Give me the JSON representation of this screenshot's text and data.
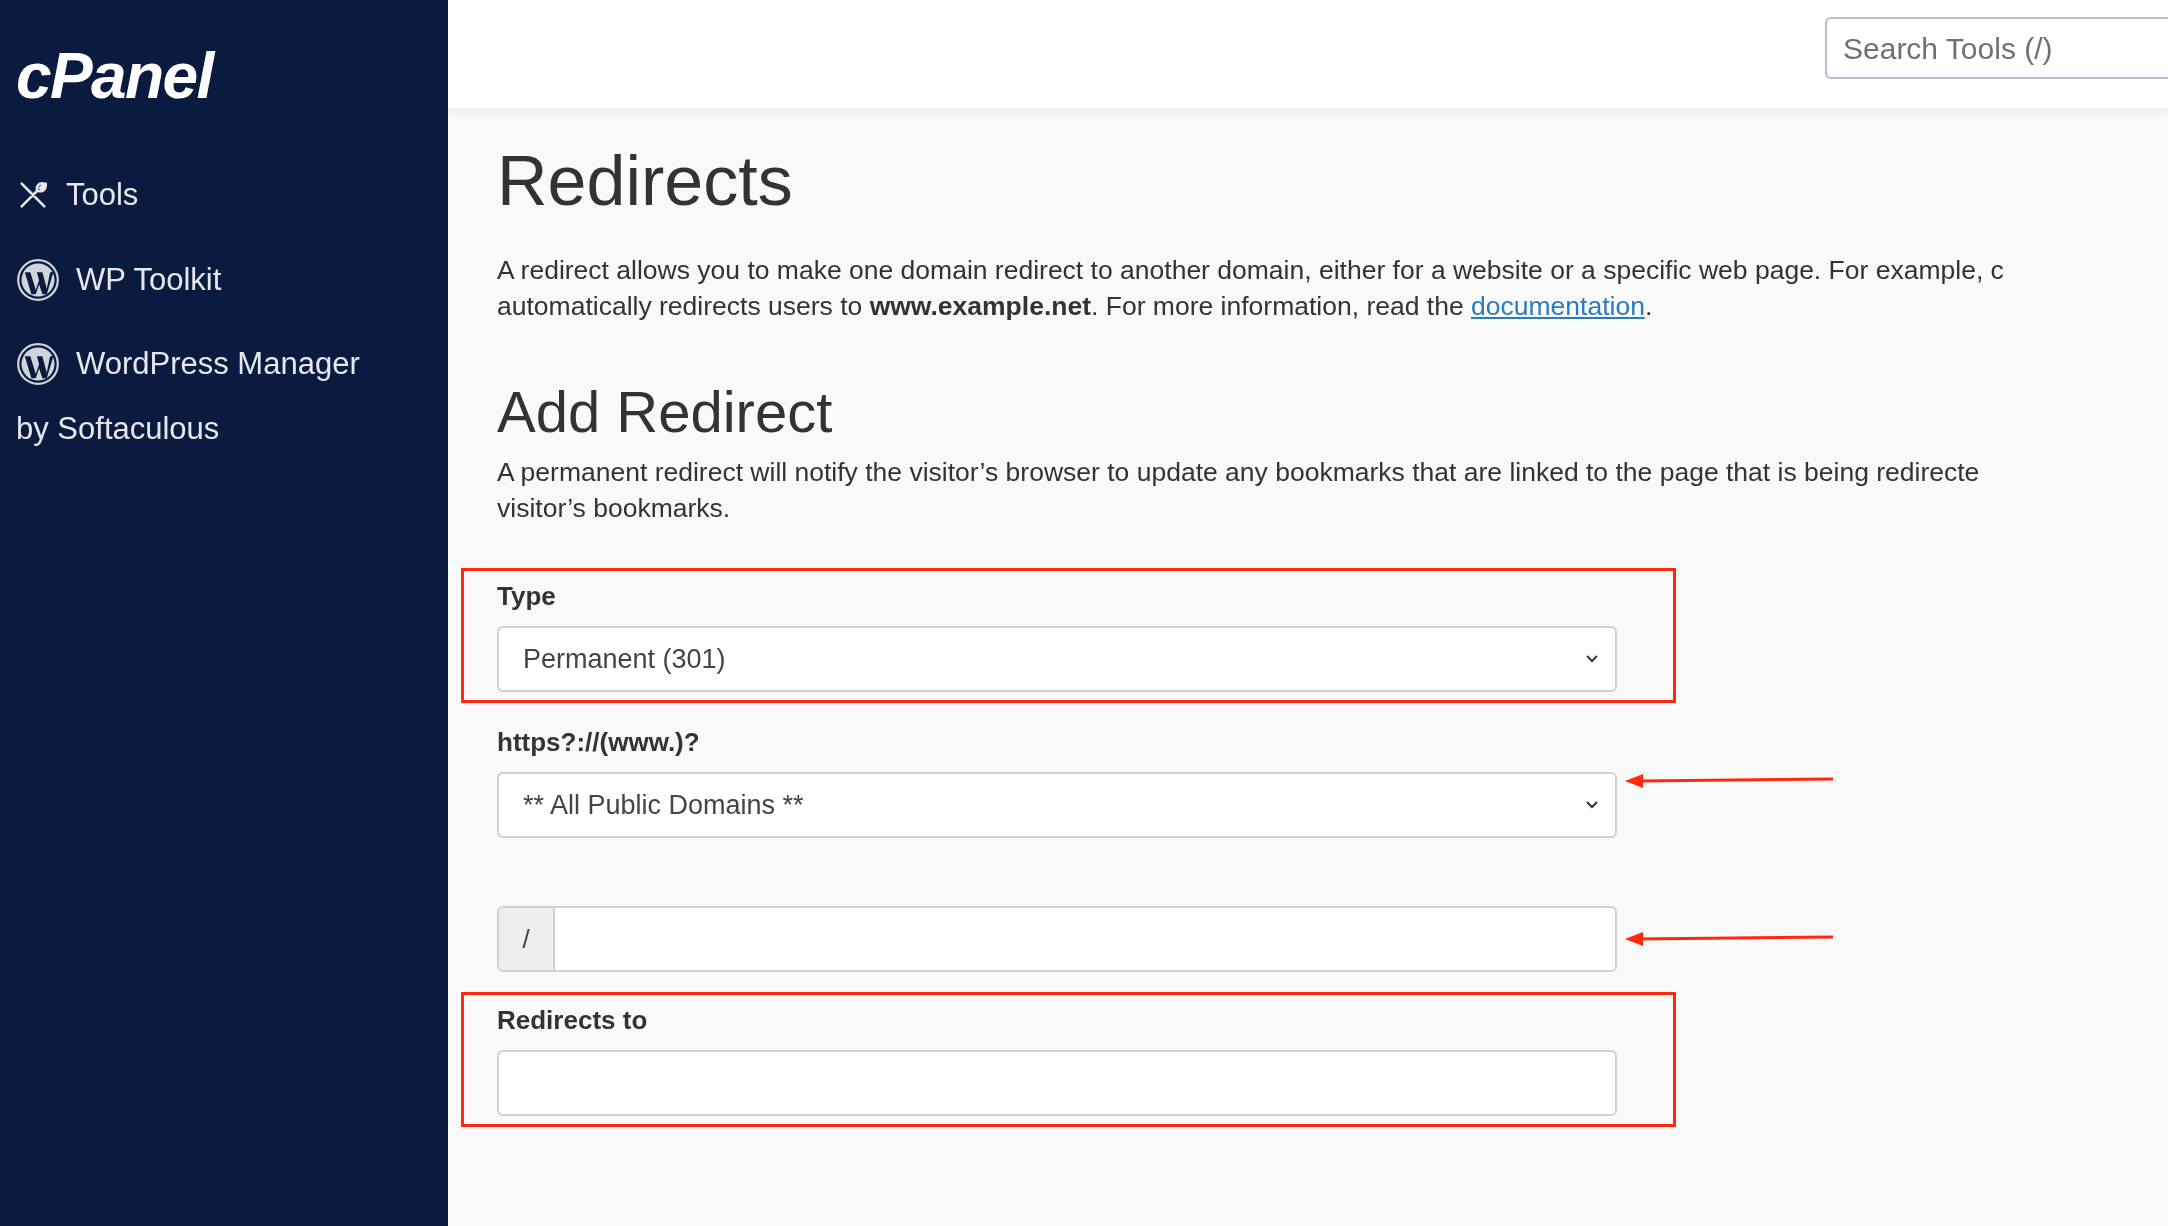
{
  "sidebar": {
    "logo": "cPanel",
    "items": [
      {
        "kind": "tools",
        "label": "Tools"
      },
      {
        "kind": "wordpress",
        "label": "WP Toolkit"
      },
      {
        "kind": "wordpress",
        "label": "WordPress Manager",
        "label_line_2": "by Softaculous"
      }
    ]
  },
  "header": {
    "search": {
      "placeholder": "Search Tools (/)"
    }
  },
  "page": {
    "title": "Redirects",
    "intro_lines": [
      "A redirect allows you to make one domain redirect to another domain, either for a website or a specific web page. For example, c"
    ],
    "intro_last_line": {
      "text": "automatically redirects users to **www.example.net**. For more information, read the ",
      "link": "documentation",
      "after": "."
    }
  },
  "add_redirect": {
    "heading": "Add Redirect",
    "description_lines": [
      "A permanent redirect will notify the visitor’s browser to update any bookmarks that are linked to the page that is being redirecte",
      "visitor’s bookmarks."
    ],
    "fields": [
      {
        "kind": "select",
        "label": "Type",
        "value": "Permanent (301)",
        "highlighted": true,
        "arrow": false
      },
      {
        "kind": "select",
        "label": "https?://(www.)?",
        "value": "** All Public Domains **",
        "highlighted": false,
        "arrow": true
      },
      {
        "kind": "path",
        "prefix": "/",
        "highlighted": false,
        "arrow": true
      },
      {
        "kind": "text",
        "label": "Redirects to",
        "highlighted": true,
        "arrow": false
      }
    ]
  }
}
